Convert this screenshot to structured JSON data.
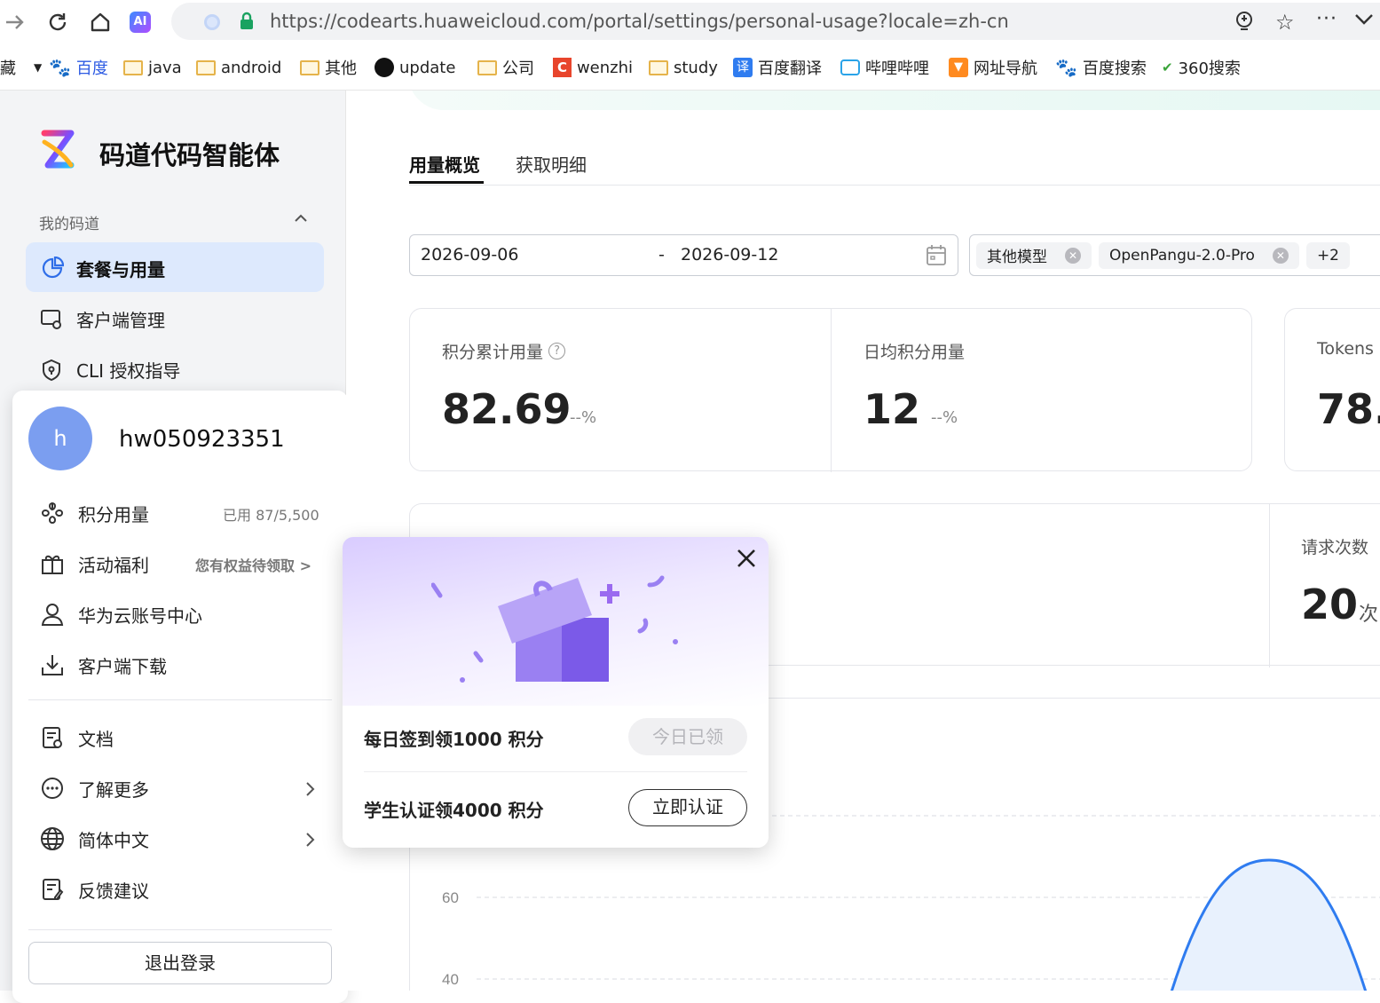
{
  "browser": {
    "url": "https://codearts.huaweicloud.com/portal/settings/personal-usage?locale=zh-cn",
    "bookmarks": [
      {
        "label": "藏",
        "icon": "none"
      },
      {
        "label": "百度",
        "icon": "baidu-paw-icon"
      },
      {
        "label": "java",
        "icon": "folder-icon"
      },
      {
        "label": "android",
        "icon": "folder-icon"
      },
      {
        "label": "其他",
        "icon": "folder-icon"
      },
      {
        "label": "update",
        "icon": "github-icon"
      },
      {
        "label": "公司",
        "icon": "folder-icon"
      },
      {
        "label": "wenzhi",
        "icon": "c-logo-icon"
      },
      {
        "label": "study",
        "icon": "folder-icon"
      },
      {
        "label": "百度翻译",
        "icon": "translate-icon"
      },
      {
        "label": "哔哩哔哩",
        "icon": "bilibili-icon"
      },
      {
        "label": "网址导航",
        "icon": "nav-flag-icon"
      },
      {
        "label": "百度搜索",
        "icon": "baidu-paw-icon"
      },
      {
        "label": "360搜索",
        "icon": "hao360-icon"
      }
    ]
  },
  "sidebar": {
    "brand": "码道代码智能体",
    "section_label": "我的码道",
    "items": [
      {
        "label": "套餐与用量",
        "active": true
      },
      {
        "label": "客户端管理",
        "active": false
      },
      {
        "label": "CLI 授权指导",
        "active": false
      }
    ]
  },
  "user_menu": {
    "avatar_letter": "h",
    "username": "hw050923351",
    "items": [
      {
        "label": "积分用量",
        "value": "已用 87/5,500"
      },
      {
        "label": "活动福利",
        "value": "您有权益待领取 >"
      },
      {
        "label": "华为云账号中心",
        "value": ""
      },
      {
        "label": "客户端下载",
        "value": ""
      }
    ],
    "items2": [
      {
        "label": "文档"
      },
      {
        "label": "了解更多"
      },
      {
        "label": "简体中文"
      },
      {
        "label": "反馈建议"
      }
    ],
    "logout": "退出登录"
  },
  "main": {
    "tabs": [
      "用量概览",
      "获取明细"
    ],
    "active_tab": "用量概览",
    "date_start": "2026-09-06",
    "date_sep": "-",
    "date_end": "2026-09-12",
    "model_tags": [
      "其他模型",
      "OpenPangu-2.0-Pro"
    ],
    "more_tag": "+2",
    "stats": [
      {
        "label": "积分累计用量",
        "value": "82.69",
        "change": "--%"
      },
      {
        "label": "日均积分用量",
        "value": "12",
        "change": "--%"
      },
      {
        "label": "Tokens",
        "value": "78.",
        "change": ""
      }
    ],
    "requests": {
      "label": "请求次数",
      "value": "20",
      "unit": "次"
    }
  },
  "popup": {
    "row1_label": "每日签到领1000 积分",
    "row1_button": "今日已领",
    "row2_label": "学生认证领4000 积分",
    "row2_button": "立即认证"
  },
  "chart_data": {
    "type": "area",
    "y_ticks": [
      "60",
      "40"
    ],
    "series_color": "#2f7cf0",
    "fill_color": "#e8f1fd"
  }
}
